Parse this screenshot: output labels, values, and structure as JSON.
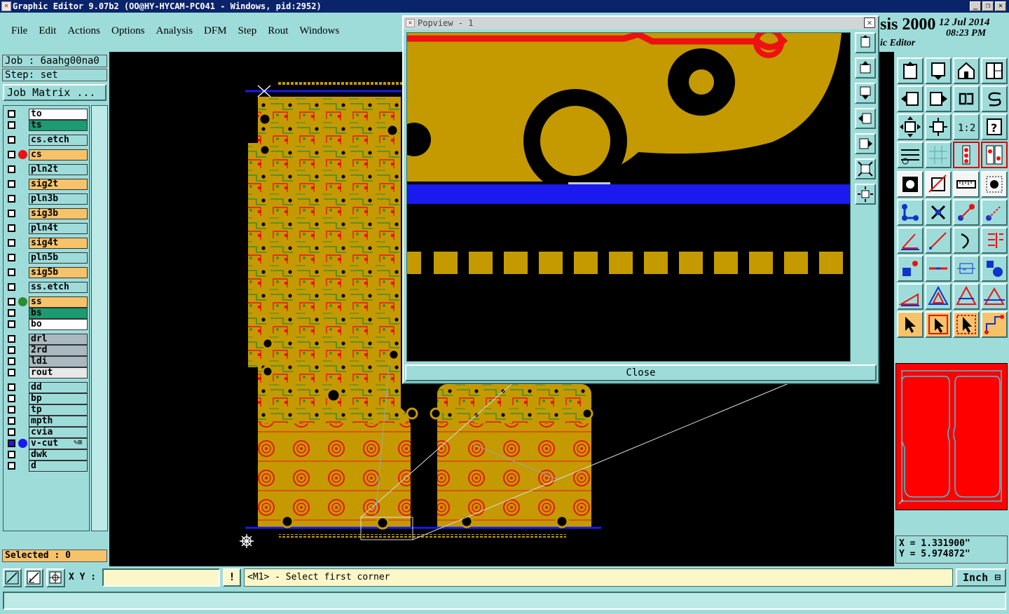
{
  "window": {
    "title": "Graphic Editor 9.07b2 (OO@HY-HYCAM-PC041 - Windows, pid:2952)",
    "buttons": [
      "_",
      "❐",
      "✕"
    ]
  },
  "menubar": {
    "items": [
      "File",
      "Edit",
      "Actions",
      "Options",
      "Analysis",
      "DFM",
      "Step",
      "Rout",
      "Windows"
    ]
  },
  "brand": {
    "title": "sis 2000",
    "subtitle": "ic Editor",
    "date": "12 Jul 2014",
    "time": "08:23 PM"
  },
  "job": {
    "job_label": "Job : 6aahg00na0",
    "step_label": "Step: set",
    "matrix_button": "Job Matrix ..."
  },
  "layers": [
    {
      "name": "to",
      "color": "#ffffff",
      "dot": ""
    },
    {
      "name": "ts",
      "color": "#1c9a72",
      "dot": ""
    },
    {
      "name": "cs.etch",
      "color": "#9edcda",
      "dot": ""
    },
    {
      "name": "cs",
      "color": "#f6c36a",
      "dot": "#ee1111"
    },
    {
      "name": "pln2t",
      "color": "#9edcda",
      "dot": ""
    },
    {
      "name": "sig2t",
      "color": "#f6c36a",
      "dot": ""
    },
    {
      "name": "pln3b",
      "color": "#9edcda",
      "dot": ""
    },
    {
      "name": "sig3b",
      "color": "#f6c36a",
      "dot": ""
    },
    {
      "name": "pln4t",
      "color": "#9edcda",
      "dot": ""
    },
    {
      "name": "sig4t",
      "color": "#f6c36a",
      "dot": ""
    },
    {
      "name": "pln5b",
      "color": "#9edcda",
      "dot": ""
    },
    {
      "name": "sig5b",
      "color": "#f6c36a",
      "dot": ""
    },
    {
      "name": "ss.etch",
      "color": "#9edcda",
      "dot": ""
    },
    {
      "name": "ss",
      "color": "#f6c36a",
      "dot": "#2e8b2e"
    },
    {
      "name": "bs",
      "color": "#1c9a72",
      "dot": ""
    },
    {
      "name": "bo",
      "color": "#ffffff",
      "dot": ""
    },
    {
      "name": "drl",
      "color": "#a9b9bf",
      "dot": ""
    },
    {
      "name": "2rd",
      "color": "#a9b9bf",
      "dot": ""
    },
    {
      "name": "ldi",
      "color": "#a9b9bf",
      "dot": ""
    },
    {
      "name": "rout",
      "color": "#e8e8e8",
      "dot": ""
    },
    {
      "name": "dd",
      "color": "#9edcda",
      "dot": ""
    },
    {
      "name": "bp",
      "color": "#9edcda",
      "dot": ""
    },
    {
      "name": "tp",
      "color": "#9edcda",
      "dot": ""
    },
    {
      "name": "mpth",
      "color": "#9edcda",
      "dot": ""
    },
    {
      "name": "cvia",
      "color": "#9edcda",
      "dot": ""
    },
    {
      "name": "v-cut",
      "color": "#9edcda",
      "dot": "#1a1aee",
      "extra": "✎⊞"
    },
    {
      "name": "dwk",
      "color": "#9edcda",
      "dot": ""
    },
    {
      "name": "d",
      "color": "#9edcda",
      "dot": ""
    }
  ],
  "selected_label": "Selected : 0",
  "popview": {
    "title": "Popview - 1",
    "close_label": "Close"
  },
  "coords": {
    "x_label": "X = 1.331900\"",
    "y_label": "Y = 5.974872\""
  },
  "command": {
    "xy_label": "X Y :",
    "xy_value": "",
    "warn": "!",
    "prompt": "<M1> - Select first corner",
    "unit": "Inch"
  },
  "colors": {
    "copper": "#c49a00",
    "trace_red": "#ee1111",
    "trace_green": "#3c8e2e",
    "vcut_blue": "#1a1aee",
    "panel": "#9edcda"
  }
}
